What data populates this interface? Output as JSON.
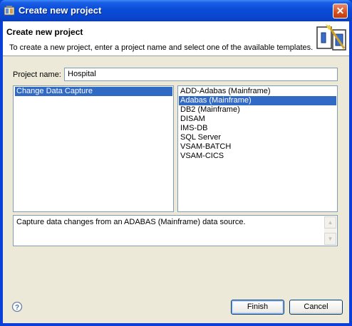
{
  "window": {
    "title": "Create new project",
    "close_glyph": "✕"
  },
  "banner": {
    "title": "Create new project",
    "description": "To create a new project, enter a project name and select one of the available templates."
  },
  "form": {
    "project_name_label": "Project name:",
    "project_name_value": "Hospital"
  },
  "categories": {
    "items": [
      {
        "label": "Change Data Capture",
        "selected": true
      }
    ]
  },
  "templates": {
    "items": [
      {
        "label": "ADD-Adabas (Mainframe)",
        "selected": false
      },
      {
        "label": "Adabas (Mainframe)",
        "selected": true
      },
      {
        "label": "DB2 (Mainframe)",
        "selected": false
      },
      {
        "label": "DISAM",
        "selected": false
      },
      {
        "label": "IMS-DB",
        "selected": false
      },
      {
        "label": "SQL Server",
        "selected": false
      },
      {
        "label": "VSAM-BATCH",
        "selected": false
      },
      {
        "label": "VSAM-CICS",
        "selected": false
      }
    ]
  },
  "description_box": {
    "text": "Capture data changes from an ADABAS (Mainframe) data source."
  },
  "buttons": {
    "finish": "Finish",
    "cancel": "Cancel"
  },
  "icons": {
    "app": "project-wizard-icon",
    "help": "help-icon",
    "banner": "wizard-banner-icon"
  }
}
